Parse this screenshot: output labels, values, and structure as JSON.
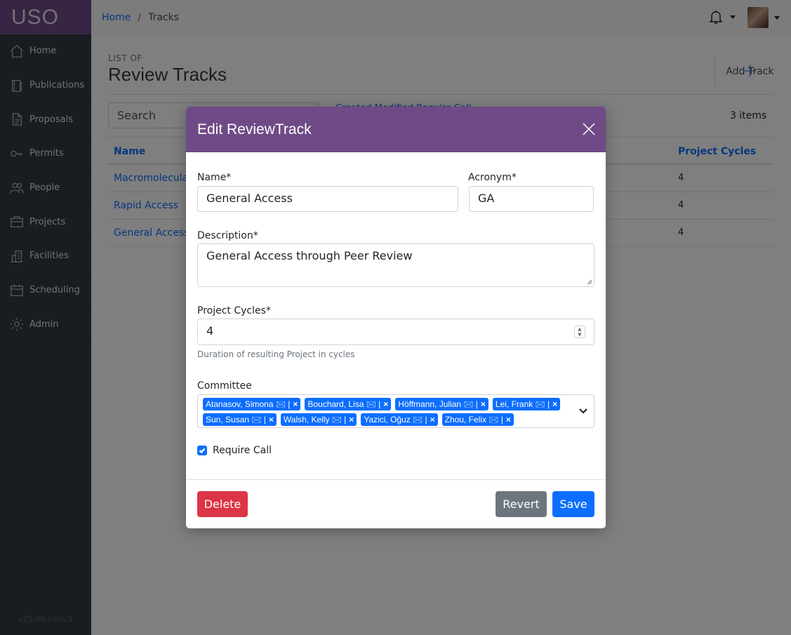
{
  "app": {
    "brand": "USO",
    "version": "v25.08-beta.3"
  },
  "sidebar": {
    "items": [
      {
        "label": "Home",
        "icon": "home-icon"
      },
      {
        "label": "Publications",
        "icon": "book-icon"
      },
      {
        "label": "Proposals",
        "icon": "document-icon"
      },
      {
        "label": "Permits",
        "icon": "key-icon"
      },
      {
        "label": "People",
        "icon": "people-icon"
      },
      {
        "label": "Projects",
        "icon": "briefcase-icon"
      },
      {
        "label": "Facilities",
        "icon": "building-icon"
      },
      {
        "label": "Scheduling",
        "icon": "calendar-icon"
      },
      {
        "label": "Admin",
        "icon": "gear-icon"
      }
    ]
  },
  "topbar": {
    "breadcrumb": {
      "home": "Home",
      "separator": "/",
      "current": "Tracks"
    }
  },
  "page": {
    "overline": "LIST OF",
    "title": "Review Tracks",
    "add_label": "Add Track",
    "search_placeholder": "Search",
    "filters": "Created  Modified  Require Call",
    "items_count": "3 items",
    "columns": {
      "name": "Name",
      "cycles": "Project Cycles"
    },
    "rows": [
      {
        "name": "Macromolecular",
        "cycles": "4"
      },
      {
        "name": "Rapid Access",
        "cycles": "4"
      },
      {
        "name": "General Access",
        "cycles": "4"
      }
    ]
  },
  "modal": {
    "title": "Edit ReviewTrack",
    "name_label": "Name*",
    "name_value": "General Access",
    "acronym_label": "Acronym*",
    "acronym_value": "GA",
    "description_label": "Description*",
    "description_value": "General Access through Peer Review",
    "cycles_label": "Project Cycles*",
    "cycles_value": "4",
    "cycles_help": "Duration of resulting Project in cycles",
    "committee_label": "Committee",
    "committee": [
      "Atanasov, Simona 🖂 |",
      "Bouchard, Lisa 🖂 |",
      "Höffmann, Julian 🖂 |",
      "Lei, Frank 🖂 |",
      "Sun, Susan 🖂 |",
      "Walsh, Kelly 🖂 |",
      "Yazici, Oğuz 🖂 |",
      "Zhou, Felix 🖂 |"
    ],
    "remove_glyph": "×",
    "require_call_label": "Require Call",
    "require_call_checked": true,
    "delete_label": "Delete",
    "revert_label": "Revert",
    "save_label": "Save"
  },
  "colors": {
    "brand_purple": "#6f4a87",
    "primary": "#0d6efd",
    "danger": "#dc3545",
    "secondary": "#6c757d",
    "sidebar_bg": "#343a40"
  }
}
